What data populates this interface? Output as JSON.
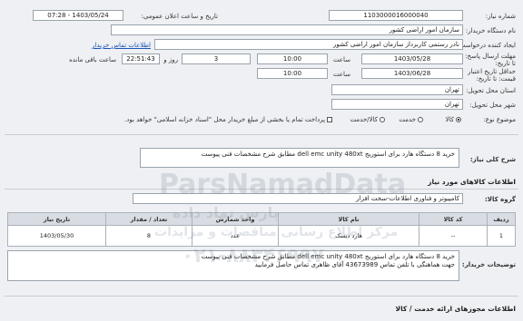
{
  "header": {
    "need_number_label": "شماره نیاز:",
    "need_number_value": "1103000016000040",
    "announce_label": "تاریخ و ساعت اعلان عمومی:",
    "announce_value": "1403/05/24 - 07:28",
    "buyer_org_label": "نام دستگاه خریدار:",
    "buyer_org_value": "سازمان امور اراضی کشور",
    "creator_label": "ایجاد کننده درخواست:",
    "creator_value": "نادر رستمی کاربرداز سازمان امور اراضی کشور",
    "buyer_contact_link": "اطلاعات تماس خریدار",
    "deadline_label": "مهلت ارسال پاسخ: تا تاریخ:",
    "deadline_date": "1403/05/28",
    "deadline_time_label": "ساعت",
    "deadline_time": "10:00",
    "deadline_days": "3",
    "days_label": "روز و",
    "remaining_time": "22:51:43",
    "remaining_label": "ساعت باقی مانده",
    "validity_label": "حداقل تاریخ اعتبار قیمت: تا تاریخ:",
    "validity_date": "1403/06/28",
    "validity_time_label": "ساعت",
    "validity_time": "10:00",
    "province_label": "استان محل تحویل:",
    "province_value": "تهران",
    "city_label": "شهر محل تحویل:",
    "city_value": "تهران",
    "category_label": "موضوع نوع:",
    "category_options": [
      "کالا",
      "خدمت",
      "کالا/خدمت"
    ],
    "category_selected": "کالا",
    "payment_note": "پرداخت تمام یا بخشی از مبلغ خریدار محل \"اسناد خزانه اسلامی\" خواهد بود."
  },
  "description": {
    "label": "شرح کلی نیاز:",
    "text": "خرید 8 دستگاه هارد برای استوریج dell  emc unity 480xt مطابق شرح مشخصات فنی پیوست"
  },
  "goods": {
    "section_title": "اطلاعات کالاهای مورد نیاز",
    "group_label": "گروه کالا:",
    "group_value": "کامپیوتر و فناوری اطلاعات-سخت افزار",
    "columns": [
      "ردیف",
      "کد کالا",
      "نام کالا",
      "واحد شمارش",
      "تعداد / مقدار",
      "تاریخ نیاز"
    ],
    "rows": [
      {
        "row": "1",
        "code": "--",
        "name": "هارد دیسک",
        "unit": "عدد",
        "qty": "8",
        "date": "1403/05/30"
      }
    ]
  },
  "buyer_notes": {
    "label": "توضیحات خریدار:",
    "line1": "خرید 8 دستگاه هارد برای استوریج dell  emc unity 480xt مطابق شرح مشخصات فنی پیوست",
    "line2": "جهت هماهنگی با تلفن تماس 43673989 آقای ظاهری تماس حاصل فرمایید"
  },
  "footer": {
    "section_title": "اطلاعات مجوزهای ارائه خدمت / کالا"
  },
  "watermark": {
    "line1": "ParsNamadData",
    "line2": "پارس نماد داده",
    "line3": "مرکز اطلاع رسانی مناقصات و مزایدات",
    "phone": "۰۲۱-۸۸۳۴۶۹۹۷"
  }
}
